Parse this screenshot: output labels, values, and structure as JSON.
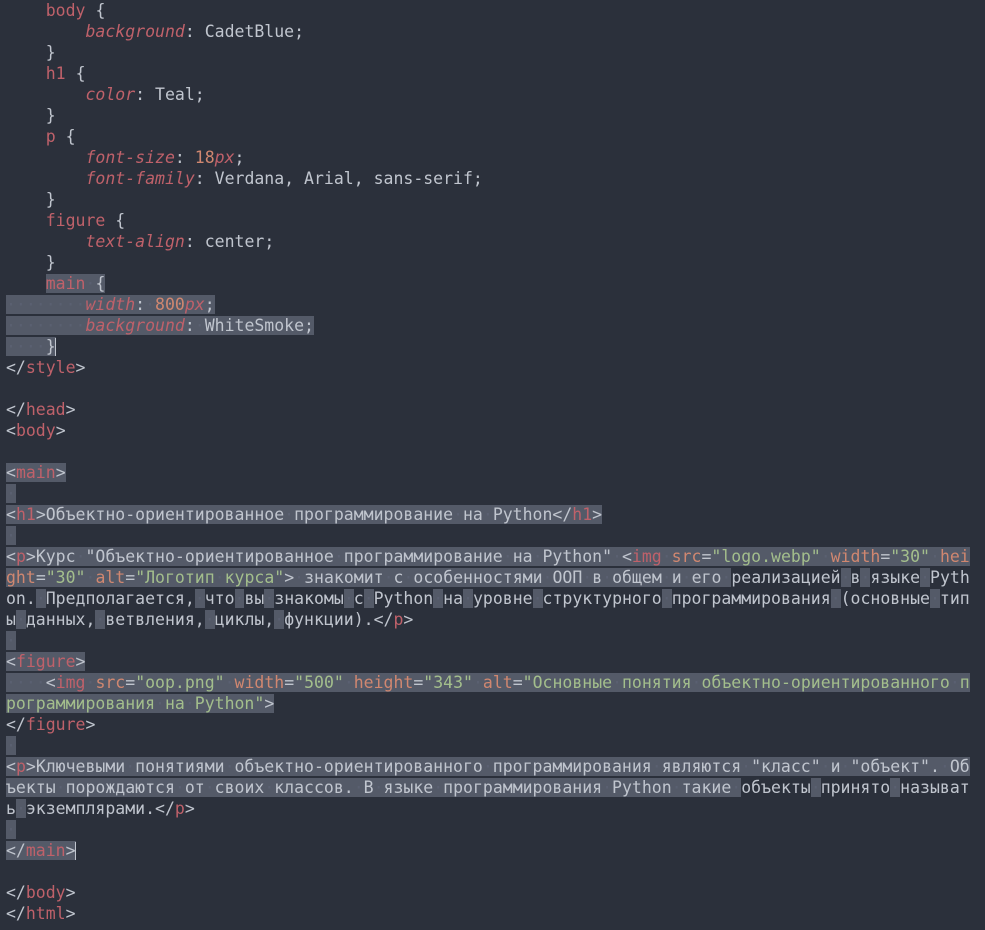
{
  "css": {
    "body_sel": "body",
    "body_prop": "background",
    "body_val": "CadetBlue",
    "h1_sel": "h1",
    "h1_prop": "color",
    "h1_val": "Teal",
    "p_sel": "p",
    "p_prop1": "font-size",
    "p_val1_num": "18",
    "p_val1_unit": "px",
    "p_prop2": "font-family",
    "p_val2": "Verdana, Arial, sans-serif",
    "figure_sel": "figure",
    "figure_prop": "text-align",
    "figure_val": "center",
    "main_sel": "main",
    "main_prop1": "width",
    "main_val1_num": "800",
    "main_val1_unit": "px",
    "main_prop2": "background",
    "main_val2": "WhiteSmoke"
  },
  "tags": {
    "style_close": "style",
    "head_close": "head",
    "body_open": "body",
    "main": "main",
    "h1": "h1",
    "p": "p",
    "img": "img",
    "figure": "figure",
    "body_close": "body",
    "html_close": "html"
  },
  "attrs": {
    "src": "src",
    "width": "width",
    "height": "height",
    "alt": "alt",
    "eq": "="
  },
  "content": {
    "h1_text": "Объектно-ориентированное программирование на Python",
    "p1_a": "Курс \"Объектно-ориентированное программирование на Python\" ",
    "img1_src": "\"logo.webp\"",
    "img1_w": "\"30\"",
    "img1_h": "\"30\"",
    "img1_alt": "\"Логотип курса\"",
    "p1_b": " знакомит с особенностями ООП в общем и его реализацией в языке Python. Предполагается, что вы знакомы с Python на уровне структурного программирования (основные типы данных, ветвления, циклы, функции).",
    "img2_src": "\"oop.png\"",
    "img2_w": "\"500\"",
    "img2_h": "\"343\"",
    "img2_alt": "\"Основные понятия объектно-ориентированного программирования на Python\"",
    "p2": "Ключевыми понятиями объектно-ориентированного программирования являются \"класс\" и \"объект\". Объекты порождаются от своих классов. В языке программирования Python такие объекты принято называть экземплярами."
  },
  "ws": {
    "dot": "·",
    "ind4": "····",
    "ind8": "········"
  }
}
